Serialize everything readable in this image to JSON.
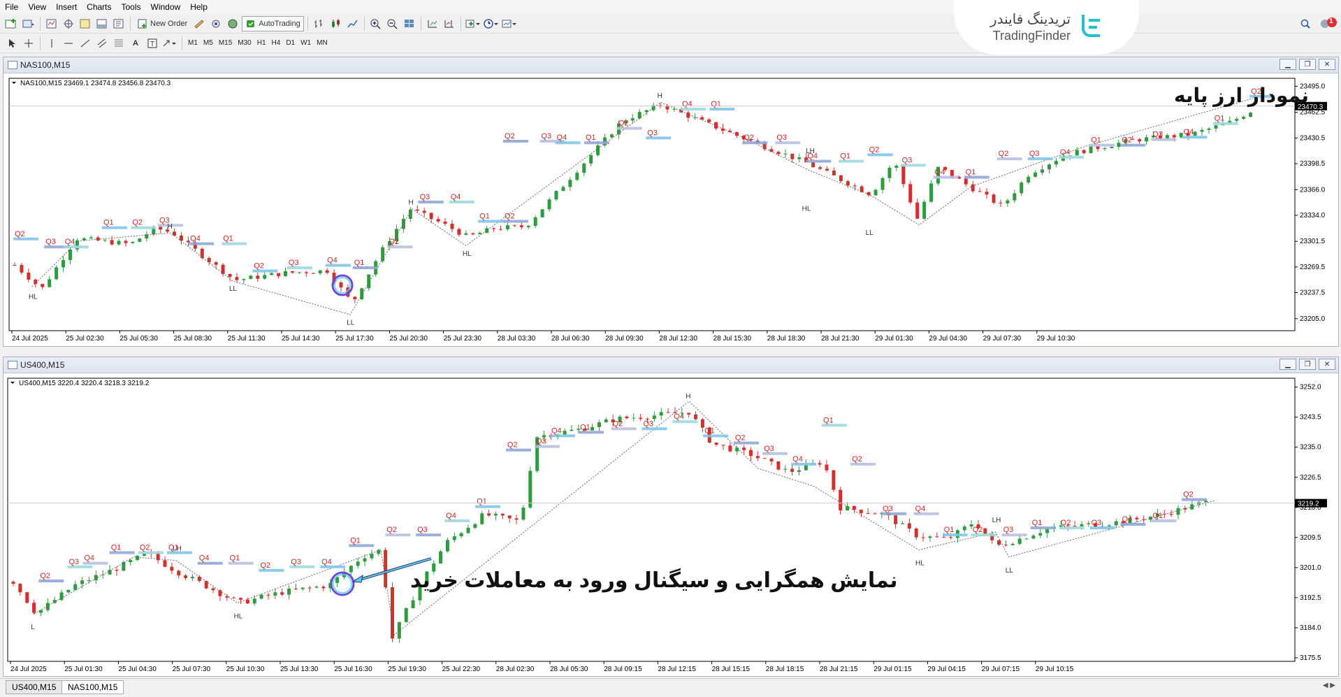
{
  "menu": [
    "File",
    "View",
    "Insert",
    "Charts",
    "Tools",
    "Window",
    "Help"
  ],
  "toolbar": {
    "new_order": "New Order",
    "autotrading": "AutoTrading"
  },
  "timeframes": [
    "M1",
    "M5",
    "M15",
    "M30",
    "H1",
    "H4",
    "D1",
    "W1",
    "MN"
  ],
  "logo": {
    "fa": "تریدینگ فایندر",
    "en": "TradingFinder"
  },
  "notification_count": "1",
  "annotations": {
    "top": "نمودار ارز پایه",
    "bottom": "نمایش همگرایی و سیگنال ورود به معاملات خرید"
  },
  "tabs": [
    "US400,M15",
    "NAS100,M15"
  ],
  "chart_data": [
    {
      "type": "candlestick",
      "window_title": "NAS100,M15",
      "info": "NAS100,M15  23469.1 23474.8 23456.8 23470.3",
      "current_price": "23470.3",
      "ylim": [
        23190,
        23505
      ],
      "y_ticks": [
        "23495.0",
        "23462.5",
        "23430.5",
        "23398.5",
        "23366.0",
        "23334.0",
        "23301.5",
        "23269.5",
        "23237.5",
        "23205.0"
      ],
      "x_ticks": [
        "24 Jul 2025",
        "25 Jul 02:30",
        "25 Jul 05:30",
        "25 Jul 08:30",
        "25 Jul 11:30",
        "25 Jul 14:30",
        "25 Jul 17:30",
        "25 Jul 20:30",
        "25 Jul 23:30",
        "28 Jul 03:30",
        "28 Jul 06:30",
        "28 Jul 09:30",
        "28 Jul 12:30",
        "28 Jul 15:30",
        "28 Jul 18:30",
        "28 Jul 21:30",
        "29 Jul 01:30",
        "29 Jul 04:30",
        "29 Jul 07:30",
        "29 Jul 10:30"
      ],
      "path": [
        [
          0,
          23272
        ],
        [
          1.4,
          23242
        ],
        [
          3.2,
          23305
        ],
        [
          6,
          23298
        ],
        [
          7.3,
          23318
        ],
        [
          8.2,
          23312
        ],
        [
          11.4,
          23253
        ],
        [
          14,
          23262
        ],
        [
          16.2,
          23265
        ],
        [
          17.5,
          23224
        ],
        [
          18.9,
          23285
        ],
        [
          20.5,
          23342
        ],
        [
          22.3,
          23322
        ],
        [
          23.5,
          23307
        ],
        [
          24.9,
          23318
        ],
        [
          26.5,
          23320
        ],
        [
          31.5,
          23452
        ],
        [
          33.5,
          23472
        ],
        [
          37.6,
          23432
        ],
        [
          41,
          23400
        ],
        [
          44.4,
          23360
        ],
        [
          45.6,
          23402
        ],
        [
          46.8,
          23330
        ],
        [
          47.9,
          23394
        ],
        [
          49.5,
          23370
        ],
        [
          51.2,
          23345
        ],
        [
          52.6,
          23386
        ],
        [
          54.5,
          23410
        ],
        [
          58,
          23428
        ],
        [
          61,
          23435
        ],
        [
          63,
          23450
        ],
        [
          64.4,
          23468
        ]
      ],
      "zigzag": [
        [
          0.9,
          23245
        ],
        [
          3.3,
          23302
        ],
        [
          8.1,
          23312
        ],
        [
          11.3,
          23252
        ],
        [
          17.4,
          23210
        ],
        [
          20.6,
          23342
        ],
        [
          23.4,
          23296
        ],
        [
          33.5,
          23475
        ],
        [
          37.7,
          23432
        ],
        [
          41.2,
          23390
        ],
        [
          44.3,
          23360
        ],
        [
          46.9,
          23322
        ],
        [
          49.6,
          23370
        ],
        [
          55.5,
          23420
        ],
        [
          64.2,
          23480
        ]
      ],
      "swing_labels": [
        {
          "t": "HL",
          "x": 0.9,
          "y": 23240,
          "pos": "below"
        },
        {
          "t": "H",
          "x": 8.1,
          "y": 23314,
          "pos": "above"
        },
        {
          "t": "LL",
          "x": 11.3,
          "y": 23250,
          "pos": "below"
        },
        {
          "t": "LL",
          "x": 17.4,
          "y": 23208,
          "pos": "below"
        },
        {
          "t": "H",
          "x": 20.6,
          "y": 23344,
          "pos": "above"
        },
        {
          "t": "HL",
          "x": 23.4,
          "y": 23294,
          "pos": "below"
        },
        {
          "t": "H",
          "x": 33.5,
          "y": 23477,
          "pos": "above"
        },
        {
          "t": "LH",
          "x": 41.2,
          "y": 23408,
          "pos": "above"
        },
        {
          "t": "HL",
          "x": 41.0,
          "y": 23350,
          "pos": "below"
        },
        {
          "t": "LL",
          "x": 44.3,
          "y": 23320,
          "pos": "below"
        }
      ],
      "q_labels": [
        {
          "t": "Q2",
          "x": 0,
          "y": 23308
        },
        {
          "t": "Q3",
          "x": 1.6,
          "y": 23298
        },
        {
          "t": "Q4",
          "x": 2.6,
          "y": 23298
        },
        {
          "t": "Q1",
          "x": 4.6,
          "y": 23322
        },
        {
          "t": "Q2",
          "x": 6.1,
          "y": 23322
        },
        {
          "t": "Q3",
          "x": 7.5,
          "y": 23325
        },
        {
          "t": "Q4",
          "x": 9.1,
          "y": 23302
        },
        {
          "t": "Q1",
          "x": 10.8,
          "y": 23302
        },
        {
          "t": "Q2",
          "x": 12.4,
          "y": 23268
        },
        {
          "t": "Q3",
          "x": 14.2,
          "y": 23272
        },
        {
          "t": "Q4",
          "x": 16.2,
          "y": 23275
        },
        {
          "t": "Q1",
          "x": 17.6,
          "y": 23272
        },
        {
          "t": "Q2",
          "x": 19.4,
          "y": 23298
        },
        {
          "t": "Q3",
          "x": 21,
          "y": 23354
        },
        {
          "t": "Q4",
          "x": 22.6,
          "y": 23354
        },
        {
          "t": "Q1",
          "x": 24.1,
          "y": 23330
        },
        {
          "t": "Q2",
          "x": 25.4,
          "y": 23330
        },
        {
          "t": "Q2",
          "x": 25.4,
          "y": 23430
        },
        {
          "t": "Q3",
          "x": 27.3,
          "y": 23430
        },
        {
          "t": "Q4",
          "x": 28.1,
          "y": 23428
        },
        {
          "t": "Q1",
          "x": 29.6,
          "y": 23428
        },
        {
          "t": "Q2",
          "x": 31.3,
          "y": 23446
        },
        {
          "t": "Q3",
          "x": 32.8,
          "y": 23434
        },
        {
          "t": "Q4",
          "x": 34.6,
          "y": 23470
        },
        {
          "t": "Q1",
          "x": 36.1,
          "y": 23470
        },
        {
          "t": "Q2",
          "x": 37.8,
          "y": 23428
        },
        {
          "t": "Q3",
          "x": 39.5,
          "y": 23428
        },
        {
          "t": "Q4",
          "x": 41.1,
          "y": 23405
        },
        {
          "t": "Q1",
          "x": 42.8,
          "y": 23405
        },
        {
          "t": "Q2",
          "x": 44.3,
          "y": 23413
        },
        {
          "t": "Q3",
          "x": 46,
          "y": 23400
        },
        {
          "t": "Q4",
          "x": 47.7,
          "y": 23385
        },
        {
          "t": "Q1",
          "x": 49.3,
          "y": 23385
        },
        {
          "t": "Q2",
          "x": 51,
          "y": 23408
        },
        {
          "t": "Q3",
          "x": 52.6,
          "y": 23408
        },
        {
          "t": "Q4",
          "x": 54.2,
          "y": 23410
        },
        {
          "t": "Q1",
          "x": 55.8,
          "y": 23425
        },
        {
          "t": "Q2",
          "x": 57.4,
          "y": 23425
        },
        {
          "t": "Q3",
          "x": 59,
          "y": 23432
        },
        {
          "t": "Q4",
          "x": 60.6,
          "y": 23435
        },
        {
          "t": "Q1",
          "x": 62.2,
          "y": 23452
        },
        {
          "t": "Q2",
          "x": 64.1,
          "y": 23486
        }
      ]
    },
    {
      "type": "candlestick",
      "window_title": "US400,M15",
      "info": "US400,M15  3220.4 3220.4 3218.3 3219.2",
      "current_price": "3219.2",
      "ylim": [
        3174.5,
        3254.5
      ],
      "y_ticks": [
        "3252.0",
        "3243.5",
        "3235.0",
        "3226.5",
        "3218.0",
        "3209.5",
        "3201.0",
        "3192.5",
        "3184.0",
        "3175.5"
      ],
      "x_ticks": [
        "24 Jul 2025",
        "25 Jul 01:30",
        "25 Jul 04:30",
        "25 Jul 07:30",
        "25 Jul 10:30",
        "25 Jul 13:30",
        "25 Jul 16:30",
        "25 Jul 19:30",
        "25 Jul 22:30",
        "28 Jul 02:30",
        "28 Jul 05:30",
        "28 Jul 09:15",
        "28 Jul 12:15",
        "28 Jul 15:15",
        "28 Jul 18:15",
        "28 Jul 21:15",
        "29 Jul 01:15",
        "29 Jul 04:15",
        "29 Jul 07:15",
        "29 Jul 10:15"
      ],
      "path": [
        [
          0,
          3197
        ],
        [
          1.2,
          3188
        ],
        [
          3.2,
          3196
        ],
        [
          5.5,
          3201
        ],
        [
          7,
          3205
        ],
        [
          8.5,
          3200
        ],
        [
          10,
          3196
        ],
        [
          11.8,
          3191
        ],
        [
          14,
          3194
        ],
        [
          16.5,
          3196
        ],
        [
          18.2,
          3204
        ],
        [
          19.2,
          3206
        ],
        [
          19.8,
          3181
        ],
        [
          21.2,
          3196
        ],
        [
          22.6,
          3208
        ],
        [
          24.6,
          3216
        ],
        [
          26.5,
          3214
        ],
        [
          27.3,
          3238
        ],
        [
          29.5,
          3240
        ],
        [
          31.5,
          3243
        ],
        [
          33.5,
          3244
        ],
        [
          35.3,
          3245
        ],
        [
          36.5,
          3236
        ],
        [
          38.5,
          3233
        ],
        [
          40.5,
          3228
        ],
        [
          42.3,
          3231
        ],
        [
          43.2,
          3218
        ],
        [
          45.5,
          3216
        ],
        [
          47.2,
          3210
        ],
        [
          48.8,
          3209
        ],
        [
          50.2,
          3214
        ],
        [
          51.3,
          3207
        ],
        [
          52.5,
          3209
        ],
        [
          54,
          3212
        ],
        [
          56,
          3213
        ],
        [
          58,
          3214
        ],
        [
          60,
          3216
        ],
        [
          62.6,
          3220
        ]
      ],
      "zigzag": [
        [
          1.1,
          3188
        ],
        [
          6.3,
          3204
        ],
        [
          8.5,
          3203
        ],
        [
          11.7,
          3191
        ],
        [
          19.2,
          3206
        ],
        [
          19.9,
          3182
        ],
        [
          35.3,
          3248
        ],
        [
          38.9,
          3229
        ],
        [
          41.8,
          3224
        ],
        [
          47.3,
          3206
        ],
        [
          51.3,
          3211
        ],
        [
          52,
          3204
        ],
        [
          62.8,
          3220
        ]
      ],
      "swing_labels": [
        {
          "t": "L",
          "x": 1.1,
          "y": 3186,
          "pos": "below"
        },
        {
          "t": "LH",
          "x": 8.5,
          "y": 3205,
          "pos": "above"
        },
        {
          "t": "HL",
          "x": 11.7,
          "y": 3189,
          "pos": "below"
        },
        {
          "t": "H",
          "x": 35.3,
          "y": 3248,
          "pos": "above"
        },
        {
          "t": "HL",
          "x": 47.3,
          "y": 3204,
          "pos": "below"
        },
        {
          "t": "LH",
          "x": 51.3,
          "y": 3213,
          "pos": "above"
        },
        {
          "t": "LL",
          "x": 52,
          "y": 3202,
          "pos": "below"
        }
      ],
      "q_labels": [
        {
          "t": "Q2",
          "x": 1.4,
          "y": 3198
        },
        {
          "t": "Q3",
          "x": 2.9,
          "y": 3202
        },
        {
          "t": "Q4",
          "x": 3.7,
          "y": 3203
        },
        {
          "t": "Q1",
          "x": 5.1,
          "y": 3206
        },
        {
          "t": "Q2",
          "x": 6.6,
          "y": 3206
        },
        {
          "t": "Q1",
          "x": 8.1,
          "y": 3206
        },
        {
          "t": "Q4",
          "x": 9.7,
          "y": 3203
        },
        {
          "t": "Q1",
          "x": 11.3,
          "y": 3203
        },
        {
          "t": "Q2",
          "x": 12.9,
          "y": 3201
        },
        {
          "t": "Q3",
          "x": 14.5,
          "y": 3202
        },
        {
          "t": "Q4",
          "x": 16.1,
          "y": 3202
        },
        {
          "t": "Q1",
          "x": 17.6,
          "y": 3208
        },
        {
          "t": "Q2",
          "x": 19.5,
          "y": 3211
        },
        {
          "t": "Q3",
          "x": 21.1,
          "y": 3211
        },
        {
          "t": "Q4",
          "x": 22.6,
          "y": 3215
        },
        {
          "t": "Q1",
          "x": 24.2,
          "y": 3219
        },
        {
          "t": "Q2",
          "x": 25.8,
          "y": 3235
        },
        {
          "t": "Q3",
          "x": 27.3,
          "y": 3236
        },
        {
          "t": "Q4",
          "x": 28.1,
          "y": 3239
        },
        {
          "t": "Q1",
          "x": 29.6,
          "y": 3240
        },
        {
          "t": "Q2",
          "x": 31.3,
          "y": 3241
        },
        {
          "t": "Q3",
          "x": 32.9,
          "y": 3241
        },
        {
          "t": "Q4",
          "x": 34.5,
          "y": 3243
        },
        {
          "t": "Q1",
          "x": 36.1,
          "y": 3239
        },
        {
          "t": "Q2",
          "x": 37.7,
          "y": 3237
        },
        {
          "t": "Q3",
          "x": 39.2,
          "y": 3234
        },
        {
          "t": "Q4",
          "x": 40.7,
          "y": 3231
        },
        {
          "t": "Q1",
          "x": 42.3,
          "y": 3242
        },
        {
          "t": "Q2",
          "x": 43.8,
          "y": 3231
        },
        {
          "t": "Q3",
          "x": 45.4,
          "y": 3217
        },
        {
          "t": "Q4",
          "x": 47.1,
          "y": 3217
        },
        {
          "t": "Q1",
          "x": 48.6,
          "y": 3211
        },
        {
          "t": "Q2",
          "x": 50.1,
          "y": 3211
        },
        {
          "t": "Q3",
          "x": 51.7,
          "y": 3211
        },
        {
          "t": "Q1",
          "x": 53.2,
          "y": 3213
        },
        {
          "t": "Q2",
          "x": 54.7,
          "y": 3213
        },
        {
          "t": "Q3",
          "x": 56.3,
          "y": 3213
        },
        {
          "t": "Q4",
          "x": 57.9,
          "y": 3214
        },
        {
          "t": "Q1",
          "x": 59.5,
          "y": 3215
        },
        {
          "t": "Q2",
          "x": 61.1,
          "y": 3221
        }
      ]
    }
  ]
}
